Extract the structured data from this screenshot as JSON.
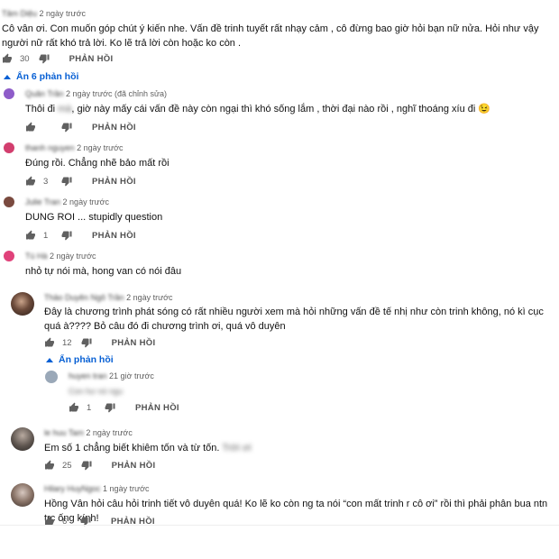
{
  "colors": {
    "accent": "#065fd4",
    "text": "#0f0f0f",
    "muted": "#606060"
  },
  "icons": {
    "like": "thumbs-up-icon",
    "dislike": "thumbs-down-icon",
    "toggle": "caret-up-icon"
  },
  "reply_label": "PHẢN HỒI",
  "top_comment": {
    "author": "Tâm Diệu",
    "time": "2 ngày trước",
    "text": "Cô vân ơi. Con muốn góp chút ý kiến nhe. Vấn đề trinh tuyết rất nhạy cảm , cô đừng bao giờ hỏi bạn nữ nửa. Hỏi như vậy người nữ rất khó trả lời. Ko lẽ trả lời còn hoặc ko còn .",
    "likes": "30"
  },
  "hide_replies_label": "Ẩn 6 phản hồi",
  "replies": [
    {
      "author": "Quân Trần",
      "time": "2 ngày trước (đã chỉnh sửa)",
      "text_pre": "Thôi đi ",
      "text_blur": "mà",
      "text_post": ", giờ này mấy cái vấn đề này còn ngại thì khó sống lắm , thời đại nào rồi , nghĩ thoáng xíu đi 😉",
      "likes": "",
      "avatar_color": "#8e5cc9"
    },
    {
      "author": "thanh nguyen",
      "time": "2 ngày trước",
      "text": "Đúng rồi. Chẳng nhẽ bảo mất rồi",
      "likes": "3",
      "avatar_color": "#d23e6e"
    },
    {
      "author": "Julie Tran",
      "time": "2 ngày trước",
      "text": "DUNG ROI ... stupidly question",
      "likes": "1",
      "avatar_color": "#7a4a3f"
    },
    {
      "author": "Tú Hà",
      "time": "2 ngày trước",
      "text": "nhỏ tự nói mà, hong van có nói đâu",
      "likes": "",
      "avatar_color": "#e0427a"
    }
  ],
  "comment2": {
    "author": "Thảo Duyên Ngô Trần",
    "time": "2 ngày trước",
    "text": "Đây là chương trình phát sóng có rất nhiều người xem mà hỏi những vấn đề tế nhị như còn trinh không, nó kì cục quá à???? Bỏ câu đó đi chương trình ơi, quá vô duyên",
    "likes": "12",
    "hide_reply_label": "Ẩn phản hồi",
    "reply": {
      "author": "huyen tran",
      "time": "21 giờ trước",
      "text": "Con hư nó ngu",
      "likes": "1"
    }
  },
  "comment3": {
    "author": "le huu Tam",
    "time": "2 ngày trước",
    "text": "Em số 1 chẳng biết khiêm tốn và từ tốn.",
    "text_blur": "Trời ơi",
    "likes": "25"
  },
  "comment4": {
    "author": "Hilary HuyNgoc",
    "time": "1 ngày trước",
    "text": "Hồng Vân hỏi câu hỏi trinh tiết vô duyên quá! Ko lẽ ko còn ng ta nói “con mất trinh r cô ơi” rồi thì phải phân bua ntn trc ống kính!",
    "likes": "6"
  }
}
